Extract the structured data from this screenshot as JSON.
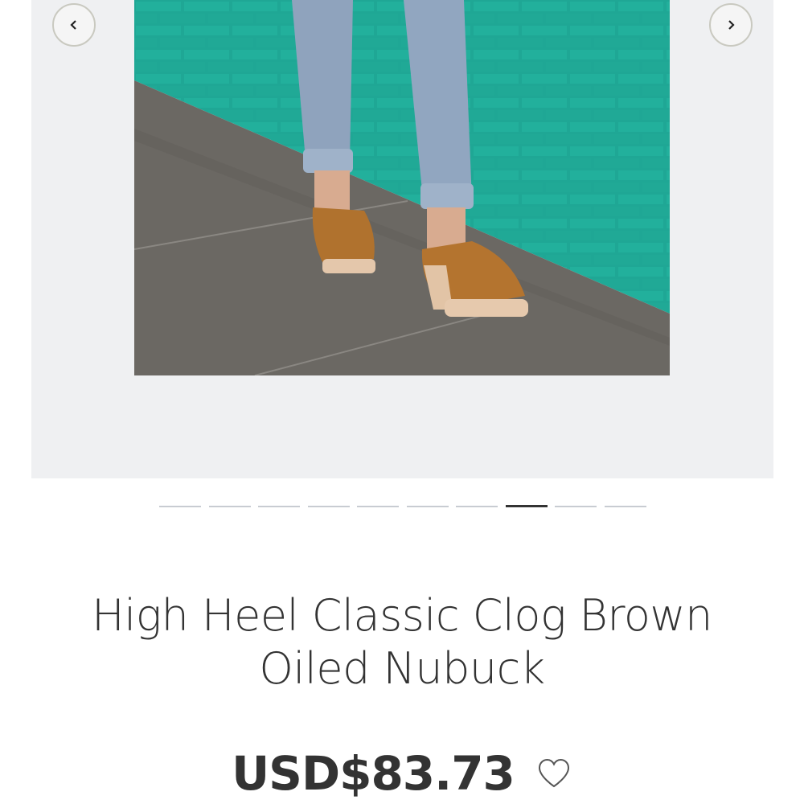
{
  "gallery": {
    "image_alt": "Person wearing high heel brown oiled nubuck clogs in front of a teal tiled wall",
    "prev_icon": "chevron-left-icon",
    "next_icon": "chevron-right-icon",
    "slide_count": 10,
    "active_slide": 8
  },
  "product": {
    "title": "High Heel Classic Clog Brown Oiled Nubuck",
    "price": "USD$83.73",
    "wishlist_icon": "heart-outline-icon"
  },
  "colors": {
    "gallery_bg": "#eff0f2",
    "text": "#333333",
    "dot_inactive": "#c8ccd2",
    "dot_active": "#333333"
  }
}
